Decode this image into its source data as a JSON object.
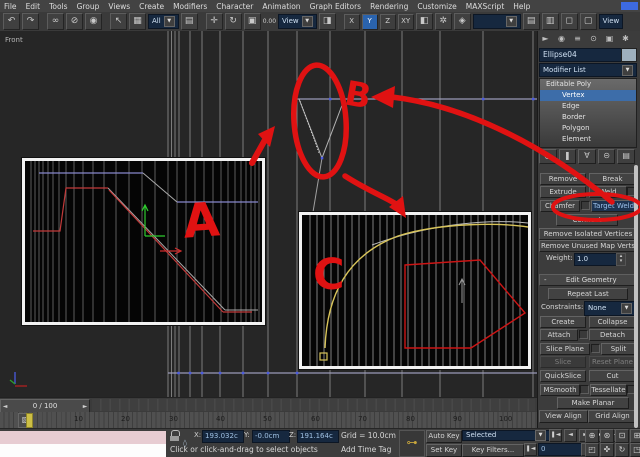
{
  "menu": {
    "items": [
      "File",
      "Edit",
      "Tools",
      "Group",
      "Views",
      "Create",
      "Modifiers",
      "Character",
      "Animation",
      "Graph Editors",
      "Rendering",
      "Customize",
      "MAXScript",
      "Help"
    ]
  },
  "toolbar": {
    "selection_filter": "All",
    "snap_value": "0.00",
    "coord_system": "View",
    "render_view": "View",
    "axes": [
      "X",
      "Y",
      "Z",
      "XY"
    ],
    "active_axis": "Y"
  },
  "icons": {
    "undo": "↶",
    "redo": "↷",
    "link": "∞",
    "unlink": "⊘",
    "bind": "◉",
    "select": "↖",
    "fence": "▦",
    "by_name": "▤",
    "window": "◫",
    "move": "✛",
    "rotate": "↻",
    "scale": "▣",
    "pivot": "◨",
    "mirror": "◧",
    "array": "✲",
    "align": "◈",
    "layers": "▤",
    "schematic": "▥",
    "material": "◻",
    "render": "▢",
    "dropdown": "▼",
    "pin": "◎",
    "showend": "❚",
    "unique": "∀",
    "remove_mod": "⊝",
    "configure": "▤",
    "start": "❚◄",
    "prev": "◄",
    "play": "►",
    "next": "►",
    "end": "►❚",
    "key_prev": "❚◄",
    "time_config": "⊙",
    "zoom": "⊕",
    "zoom_all": "⊛",
    "extents": "⊡",
    "extents_all": "⊞",
    "region": "◰",
    "pan": "✜",
    "arc": "↻",
    "maximize": "◳",
    "lock": "⊠",
    "absolute": "◊",
    "setkey": "⊶",
    "mini_curve": "▧",
    "slider_left": "◄",
    "slider_right": "►"
  },
  "viewport": {
    "label": "Front"
  },
  "annotations": {
    "a": "A",
    "b": "B",
    "c": "C"
  },
  "panel": {
    "object_name": "Ellipse04",
    "modifier_list": "Modifier List",
    "stack": {
      "root": "Editable Poly",
      "sub": [
        "Vertex",
        "Edge",
        "Border",
        "Polygon",
        "Element"
      ],
      "selected": "Vertex"
    },
    "edit_vertices": {
      "remove": "Remove",
      "break": "Break",
      "extrude": "Extrude",
      "weld": "Weld",
      "chamfer": "Chamfer",
      "target_weld": "Target Weld",
      "connect": "Connect",
      "remove_isolated": "Remove Isolated Vertices",
      "remove_unused": "Remove Unused Map Verts",
      "weight_label": "Weight:",
      "weight_value": "1.0"
    },
    "edit_geometry": {
      "collapse_sign": "-",
      "header": "Edit Geometry",
      "repeat_last": "Repeat Last",
      "constraints_label": "Constraints:",
      "constraints_value": "None",
      "create": "Create",
      "collapse": "Collapse",
      "attach": "Attach",
      "detach": "Detach",
      "slice_plane": "Slice Plane",
      "split": "Split",
      "slice": "Slice",
      "reset_plane": "Reset Plane",
      "quickslice": "QuickSlice",
      "cut": "Cut",
      "msmooth": "MSmooth",
      "tessellate": "Tessellate",
      "make_planar": "Make Planar",
      "view_align": "View Align",
      "grid_align": "Grid Align"
    }
  },
  "timeline": {
    "slider": "0 / 100",
    "ticks": [
      "10",
      "20",
      "30",
      "40",
      "50",
      "60",
      "70",
      "80",
      "90",
      "100"
    ]
  },
  "status": {
    "x_label": "X:",
    "x_value": "193.032c",
    "y_label": "Y:",
    "y_value": "-0.0cm",
    "z_label": "Z:",
    "z_value": "191.164c",
    "grid": "Grid = 10.0cm",
    "prompt": "Click or click-and-drag to select objects",
    "add_time_tag": "Add Time Tag",
    "auto_key": "Auto Key",
    "set_key": "Set Key",
    "key_mode": "Selected",
    "key_filters": "Key Filters...",
    "frame": "0"
  }
}
